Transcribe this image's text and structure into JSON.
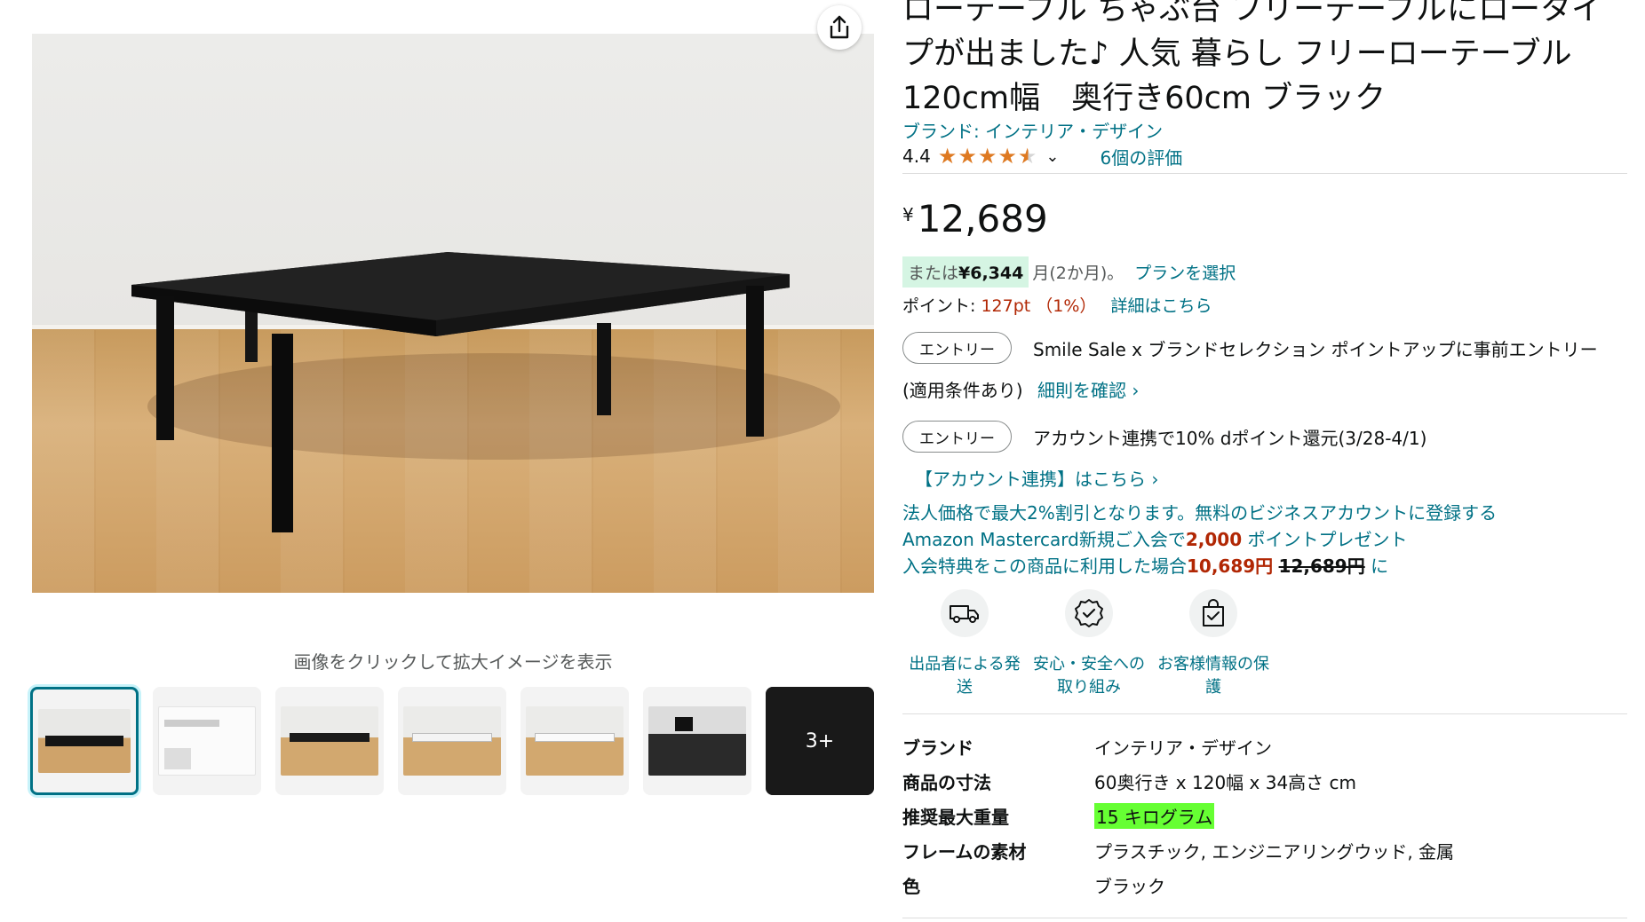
{
  "gallery": {
    "hint": "画像をクリックして拡大イメージを表示",
    "more_label": "3+"
  },
  "product": {
    "title": "ローテーブル ちゃぶ台 フリーテーブルにロータイプが出ました♪ 人気 暮らし フリーローテーブル　120cm幅　奥行き60cm ブラック",
    "brand_link": "ブランド: インテリア・デザイン",
    "rating": "4.4",
    "rating_value": 4.4,
    "review_count": "6個の評価"
  },
  "price": {
    "symbol": "¥",
    "amount": "12,689",
    "installment_prefix": "または",
    "installment_amount": "¥6,344",
    "installment_suffix": "月(2か月)。",
    "plan_link": "プランを選択",
    "points_label": "ポイント:",
    "points_value": "127pt （1%）",
    "points_link": "詳細はこちら"
  },
  "promotions": {
    "entry_label": "エントリー",
    "promo1_text": "Smile Sale x ブランドセレクション ポイントアップに事前エントリー",
    "promo1_condition": "(適用条件あり)",
    "promo1_link": "細則を確認 ›",
    "promo2_text": "アカウント連携で10% dポイント還元(3/28-4/1)",
    "promo2_link": "【アカウント連携】はこちら ›",
    "business_line": "法人価格で最大2%割引となります。無料のビジネスアカウントに登録する",
    "mc_line1_prefix": "Amazon Mastercard新規ご入会で",
    "mc_line1_points": "2,000",
    "mc_line1_suffix": " ポイントプレゼント",
    "mc_line2_prefix": "入会特典をこの商品に利用した場合",
    "mc_line2_price": "10,689円",
    "mc_line2_old": "12,689円",
    "mc_line2_suffix": " に"
  },
  "badges": [
    {
      "icon": "delivery-truck-icon",
      "label": "出品者による発送"
    },
    {
      "icon": "safety-shield-icon",
      "label": "安心・安全への取り組み"
    },
    {
      "icon": "secure-bag-icon",
      "label": "お客様情報の保護"
    }
  ],
  "specs": [
    {
      "key": "ブランド",
      "value": "インテリア・デザイン"
    },
    {
      "key": "商品の寸法",
      "value": "60奥行き x 120幅 x 34高さ cm"
    },
    {
      "key": "推奨最大重量",
      "value": "15 キログラム"
    },
    {
      "key": "フレームの素材",
      "value": "プラスチック, エンジニアリングウッド, 金属"
    },
    {
      "key": "色",
      "value": "ブラック"
    }
  ],
  "colors": {
    "link": "#007185",
    "price_red": "#b12704",
    "star": "#de7921",
    "highlight": "#66ff33",
    "installment_bg": "#d5f5e3"
  }
}
